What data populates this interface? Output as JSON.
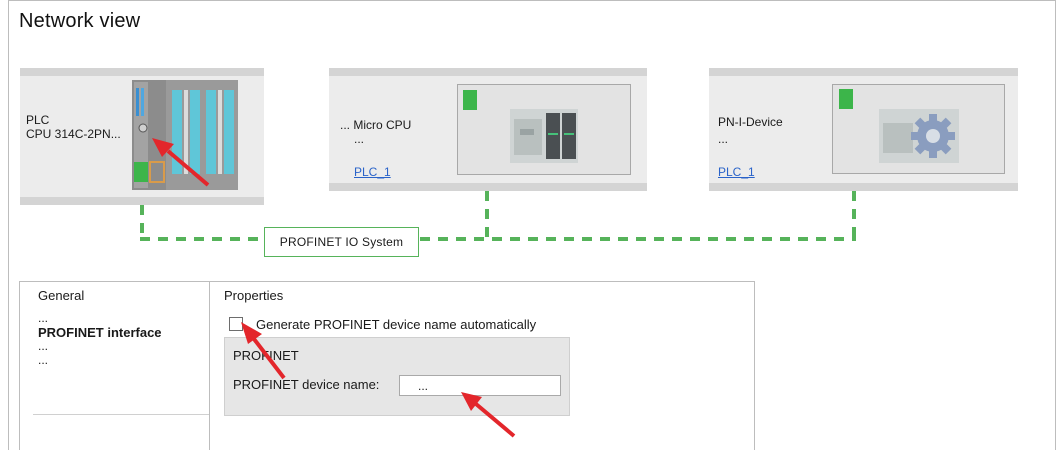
{
  "window": {
    "title": "Network view"
  },
  "devices": [
    {
      "name_line1": "PLC",
      "name_line2": "CPU 314C-2PN...",
      "link": ""
    },
    {
      "name_line1": "... Micro CPU",
      "name_line2": "...",
      "link": "PLC_1"
    },
    {
      "name_line1": "PN-I-Device",
      "name_line2": "...",
      "link": "PLC_1"
    }
  ],
  "network": {
    "label": "PROFINET IO System"
  },
  "nav": {
    "title": "General",
    "items": [
      "...",
      "PROFINET interface",
      "...",
      "..."
    ]
  },
  "properties": {
    "title": "Properties",
    "checkbox_label": "Generate PROFINET device name automatically",
    "checkbox_checked": false,
    "group_title": "PROFINET",
    "device_name_label": "PROFINET device name:",
    "device_name_value": "..."
  },
  "colors": {
    "status_green": "#3cb54a",
    "network_line": "#56b35a",
    "annotation_arrow": "#e3262b",
    "link": "#2a63c9"
  }
}
